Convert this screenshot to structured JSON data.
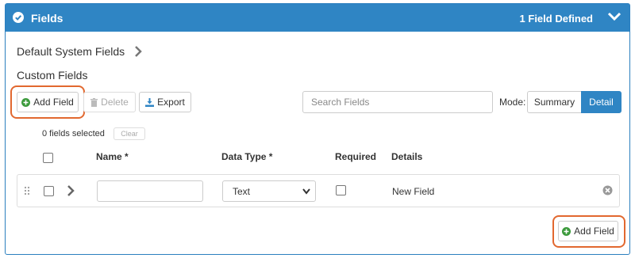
{
  "header": {
    "title": "Fields",
    "count_text": "1 Field Defined",
    "check_icon": "check-circle-icon",
    "collapse_icon": "chevron-down-icon"
  },
  "system_fields": {
    "label": "Default System Fields"
  },
  "custom_fields": {
    "label": "Custom Fields"
  },
  "toolbar": {
    "add_field": "Add Field",
    "delete": "Delete",
    "export": "Export",
    "search_placeholder": "Search Fields",
    "mode_label": "Mode:",
    "mode_summary": "Summary",
    "mode_detail": "Detail",
    "active_mode": "Detail"
  },
  "selection": {
    "count_text": "0 fields selected",
    "clear": "Clear"
  },
  "columns": {
    "name": "Name *",
    "data_type": "Data Type *",
    "required": "Required",
    "details": "Details"
  },
  "rows": [
    {
      "name": "",
      "data_type": "Text",
      "required": false,
      "details": "New Field"
    }
  ],
  "footer": {
    "add_field": "Add Field"
  },
  "colors": {
    "primary": "#2f85c4",
    "highlight": "#e2682f",
    "add_icon": "#3c9a3c"
  }
}
